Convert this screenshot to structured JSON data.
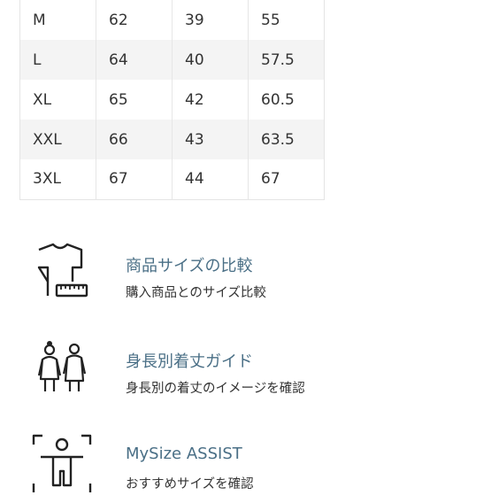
{
  "size_table": {
    "rows": [
      [
        "M",
        "62",
        "39",
        "55"
      ],
      [
        "L",
        "64",
        "40",
        "57.5"
      ],
      [
        "XL",
        "65",
        "42",
        "60.5"
      ],
      [
        "XXL",
        "66",
        "43",
        "63.5"
      ],
      [
        "3XL",
        "67",
        "44",
        "67"
      ]
    ]
  },
  "guides": [
    {
      "icon": "tshirt-measure-icon",
      "title": "商品サイズの比較",
      "desc": "購入商品とのサイズ比較"
    },
    {
      "icon": "body-height-figures-icon",
      "title": "身長別着丈ガイド",
      "desc": "身長別の着丈のイメージを確認"
    },
    {
      "icon": "body-scan-icon",
      "title": "MySize ASSIST",
      "desc": "おすすめサイズを確認"
    }
  ],
  "colors": {
    "link": "#4a6f86",
    "stripe": "#f4f4f4",
    "border": "#e4e4e4"
  }
}
